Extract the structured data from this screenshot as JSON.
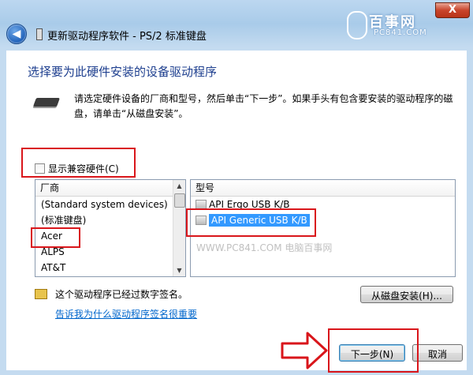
{
  "window": {
    "title": "更新驱动程序软件 - PS/2 标准键盘",
    "close_label": "X"
  },
  "watermark_logo": {
    "main": "百事网",
    "sub": "PC841.COM"
  },
  "heading": "选择要为此硬件安装的设备驱动程序",
  "instruction": "请选定硬件设备的厂商和型号，然后单击“下一步”。如果手头有包含要安装的驱动程序的磁盘，请单击“从磁盘安装”。",
  "compat_checkbox": {
    "label": "显示兼容硬件(C)",
    "checked": false
  },
  "manufacturer_list": {
    "header": "厂商",
    "items": [
      "(Standard system devices)",
      "(标准键盘)",
      "Acer",
      "ALPS",
      "AT&T"
    ],
    "highlighted_index": 2
  },
  "model_list": {
    "header": "型号",
    "items": [
      "API Ergo USB K/B",
      "API Generic USB K/B"
    ],
    "selected_index": 1
  },
  "watermark_text": "WWW.PC841.COM 电脑百事网",
  "signature_text": "这个驱动程序已经过数字签名。",
  "signature_link": "告诉我为什么驱动程序签名很重要",
  "buttons": {
    "have_disk": "从磁盘安装(H)...",
    "next": "下一步(N)",
    "cancel": "取消"
  },
  "colors": {
    "highlight_red": "#d9161b",
    "selection_blue": "#3399ff",
    "heading_blue": "#1e3f8f",
    "link_blue": "#0066cc"
  }
}
